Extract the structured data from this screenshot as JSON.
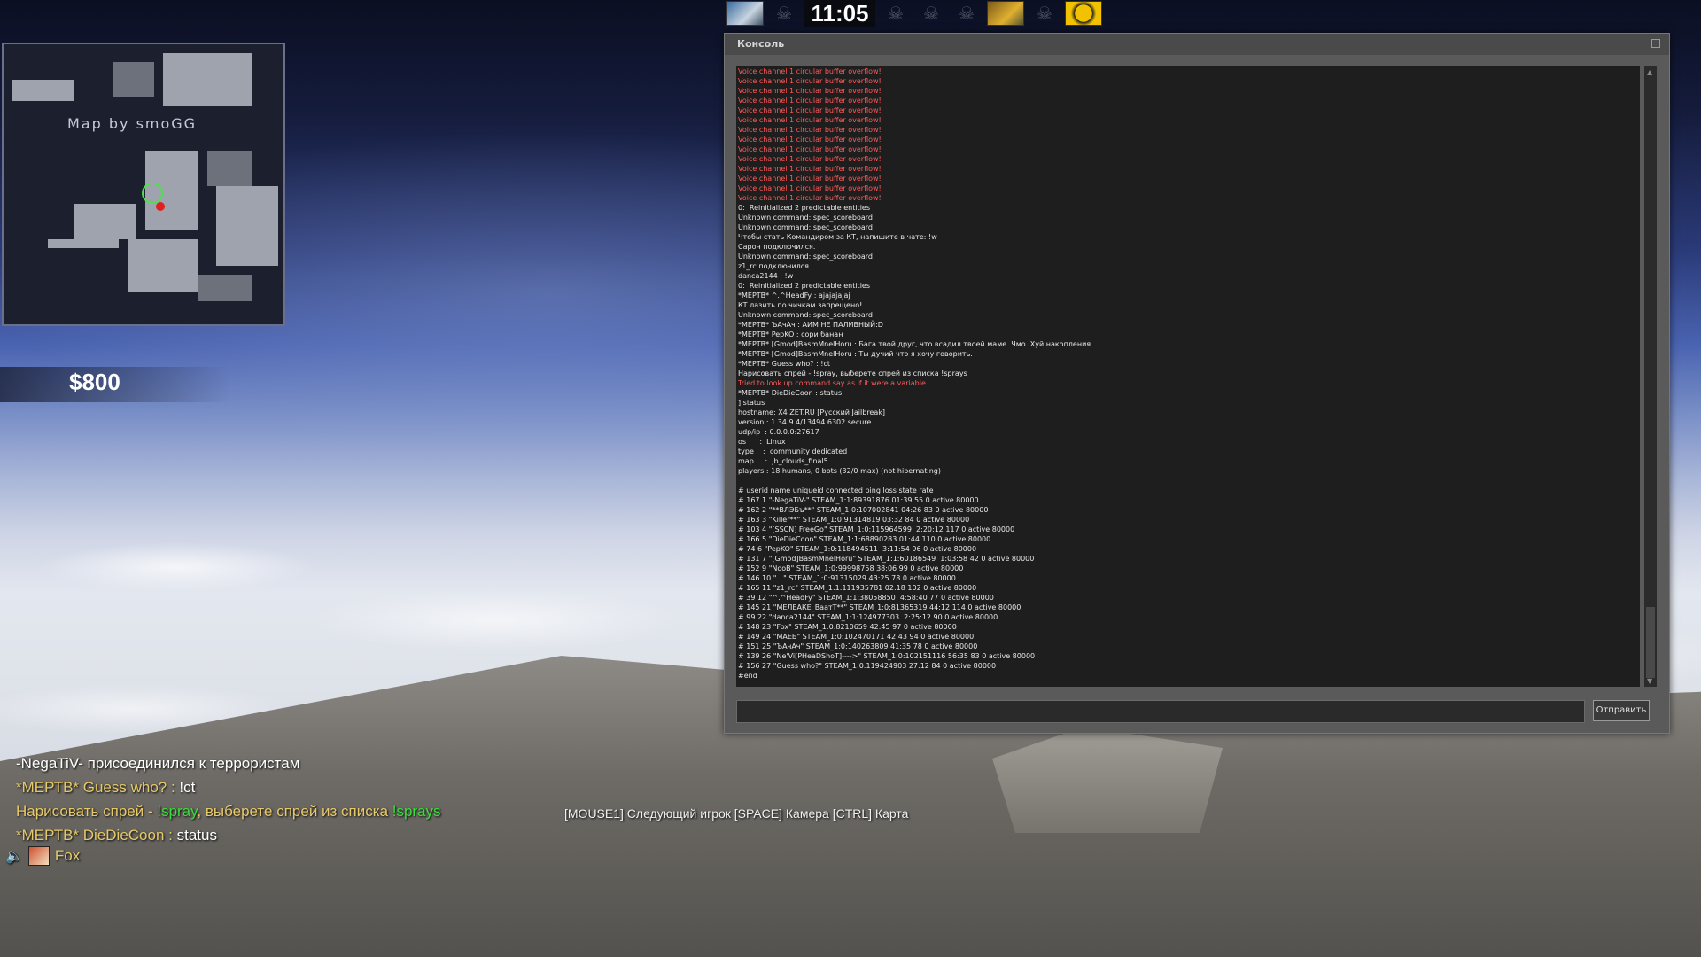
{
  "hud": {
    "timer": "11:05",
    "money": "$800"
  },
  "minimap": {
    "label": "Map by smoGG"
  },
  "console": {
    "title": "Консоль",
    "send_label": "Отправить",
    "input_value": "",
    "lines": [
      {
        "t": "Voice channel 1 circular buffer overflow!",
        "c": "red"
      },
      {
        "t": "Voice channel 1 circular buffer overflow!",
        "c": "red"
      },
      {
        "t": "Voice channel 1 circular buffer overflow!",
        "c": "red"
      },
      {
        "t": "Voice channel 1 circular buffer overflow!",
        "c": "red"
      },
      {
        "t": "Voice channel 1 circular buffer overflow!",
        "c": "red"
      },
      {
        "t": "Voice channel 1 circular buffer overflow!",
        "c": "red"
      },
      {
        "t": "Voice channel 1 circular buffer overflow!",
        "c": "red"
      },
      {
        "t": "Voice channel 1 circular buffer overflow!",
        "c": "red"
      },
      {
        "t": "Voice channel 1 circular buffer overflow!",
        "c": "red"
      },
      {
        "t": "Voice channel 1 circular buffer overflow!",
        "c": "red"
      },
      {
        "t": "Voice channel 1 circular buffer overflow!",
        "c": "red"
      },
      {
        "t": "Voice channel 1 circular buffer overflow!",
        "c": "red"
      },
      {
        "t": "Voice channel 1 circular buffer overflow!",
        "c": "red"
      },
      {
        "t": "Voice channel 1 circular buffer overflow!",
        "c": "red"
      },
      {
        "t": "0:  Reinitialized 2 predictable entities",
        "c": "w"
      },
      {
        "t": "Unknown command: spec_scoreboard",
        "c": "w"
      },
      {
        "t": "Unknown command: spec_scoreboard",
        "c": "w"
      },
      {
        "t": "Чтобы стать Командиром за КТ, напишите в чате: !w",
        "c": "w"
      },
      {
        "t": "Сарон подключился.",
        "c": "w"
      },
      {
        "t": "Unknown command: spec_scoreboard",
        "c": "w"
      },
      {
        "t": "z1_rc подключился.",
        "c": "w"
      },
      {
        "t": "danca2144 : !w",
        "c": "w"
      },
      {
        "t": "0:  Reinitialized 2 predictable entities",
        "c": "w"
      },
      {
        "t": "*МЕРТВ* ^.^HeadFy : ajajajajaj",
        "c": "w"
      },
      {
        "t": "КТ лазить по чичкам запрещено!",
        "c": "w"
      },
      {
        "t": "Unknown command: spec_scoreboard",
        "c": "w"
      },
      {
        "t": "*МЕРТВ* ЪАчАч : АИМ НЕ ПАЛИВНЫЙ:D",
        "c": "w"
      },
      {
        "t": "*МЕРТВ* PepKO : сори банан",
        "c": "w"
      },
      {
        "t": "*МЕРТВ* [Gmod]BasmMnelHoru : Бага твой друг, что всадил твоей маме. Чмо. Хуй накопления",
        "c": "w"
      },
      {
        "t": "*МЕРТВ* [Gmod]BasmMnelHoru : Ты дучий что я хочу говорить.",
        "c": "w"
      },
      {
        "t": "*МЕРТВ* Guess who? : !ct",
        "c": "w"
      },
      {
        "t": "Нарисовать спрей - !spray, выберете спрей из списка !sprays",
        "c": "w"
      },
      {
        "t": "Tried to look up command say as if it were a variable.",
        "c": "red"
      },
      {
        "t": "*МЕРТВ* DieDieCoon : status",
        "c": "w"
      },
      {
        "t": "] status",
        "c": "w"
      },
      {
        "t": "hostname: X4 ZET.RU [Русский Jailbreak]",
        "c": "w"
      },
      {
        "t": "version : 1.34.9.4/13494 6302 secure",
        "c": "w"
      },
      {
        "t": "udp/ip  : 0.0.0.0:27617",
        "c": "w"
      },
      {
        "t": "os      :  Linux",
        "c": "w"
      },
      {
        "t": "type    :  community dedicated",
        "c": "w"
      },
      {
        "t": "map     :  jb_clouds_final5",
        "c": "w"
      },
      {
        "t": "players : 18 humans, 0 bots (32/0 max) (not hibernating)",
        "c": "w"
      },
      {
        "t": "",
        "c": "w"
      },
      {
        "t": "# userid name uniqueid connected ping loss state rate",
        "c": "w"
      },
      {
        "t": "# 167 1 \"-NegaTiV-\" STEAM_1:1:89391876 01:39 55 0 active 80000",
        "c": "w"
      },
      {
        "t": "# 162 2 \"**ВЛЭБъ**\" STEAM_1:0:107002841 04:26 83 0 active 80000",
        "c": "w"
      },
      {
        "t": "# 163 3 \"Killer**\" STEAM_1:0:91314819 03:32 84 0 active 80000",
        "c": "w"
      },
      {
        "t": "# 103 4 \"[SSCN] FreeGo\" STEAM_1:0:115964599  2:20:12 117 0 active 80000",
        "c": "w"
      },
      {
        "t": "# 166 5 \"DieDieCoon\" STEAM_1:1:68890283 01:44 110 0 active 80000",
        "c": "w"
      },
      {
        "t": "# 74 6 \"PepKO\" STEAM_1:0:118494511  3:11:54 96 0 active 80000",
        "c": "w"
      },
      {
        "t": "# 131 7 \"[Gmod]BasmMnelHoru\" STEAM_1:1:60186549  1:03:58 42 0 active 80000",
        "c": "w"
      },
      {
        "t": "# 152 9 \"NooB\" STEAM_1:0:99998758 38:06 99 0 active 80000",
        "c": "w"
      },
      {
        "t": "# 146 10 \"...\" STEAM_1:0:91315029 43:25 78 0 active 80000",
        "c": "w"
      },
      {
        "t": "# 165 11 \"z1_rc\" STEAM_1:1:111935781 02:18 102 0 active 80000",
        "c": "w"
      },
      {
        "t": "# 39 12 \"^.^HeadFy\" STEAM_1:1:38058850  4:58:40 77 0 active 80000",
        "c": "w"
      },
      {
        "t": "# 145 21 \"МЕЛЕАКЕ_ВаатТ**\" STEAM_1:0:81365319 44:12 114 0 active 80000",
        "c": "w"
      },
      {
        "t": "# 99 22 \"danca2144\" STEAM_1:1:124977303  2:25:12 90 0 active 80000",
        "c": "w"
      },
      {
        "t": "# 148 23 \"Fox\" STEAM_1:0:8210659 42:45 97 0 active 80000",
        "c": "w"
      },
      {
        "t": "# 149 24 \"МАЕБ\" STEAM_1:0:102470171 42:43 94 0 active 80000",
        "c": "w"
      },
      {
        "t": "# 151 25 \"ЪАчАч\" STEAM_1:0:140263809 41:35 78 0 active 80000",
        "c": "w"
      },
      {
        "t": "# 139 26 \"Ne'Vi[PHeaDShoT]---->\" STEAM_1:0:102151116 56:35 83 0 active 80000",
        "c": "w"
      },
      {
        "t": "# 156 27 \"Guess who?\" STEAM_1:0:119424903 27:12 84 0 active 80000",
        "c": "w"
      },
      {
        "t": "#end",
        "c": "w"
      }
    ]
  },
  "chat": [
    [
      {
        "t": "-NegaTiV- присоединился к террористам",
        "c": "white"
      }
    ],
    [
      {
        "t": "*МЕРТВ* Guess who? : ",
        "c": "yellow"
      },
      {
        "t": "!ct",
        "c": "white"
      }
    ],
    [
      {
        "t": "Нарисовать спрей - ",
        "c": "yellow"
      },
      {
        "t": "!spray",
        "c": "green"
      },
      {
        "t": ", выберете спрей из списка ",
        "c": "yellow"
      },
      {
        "t": "!sprays",
        "c": "green"
      }
    ],
    [
      {
        "t": "*МЕРТВ* DieDieCoon : ",
        "c": "yellow"
      },
      {
        "t": "status",
        "c": "white"
      }
    ]
  ],
  "voice": {
    "speaker": "Fox"
  },
  "spectator_hint": "[MOUSE1] Следующий игрок [SPACE] Камера [CTRL] Карта",
  "icons": {
    "speaker": "speaker-icon",
    "skull": "skull-icon"
  }
}
